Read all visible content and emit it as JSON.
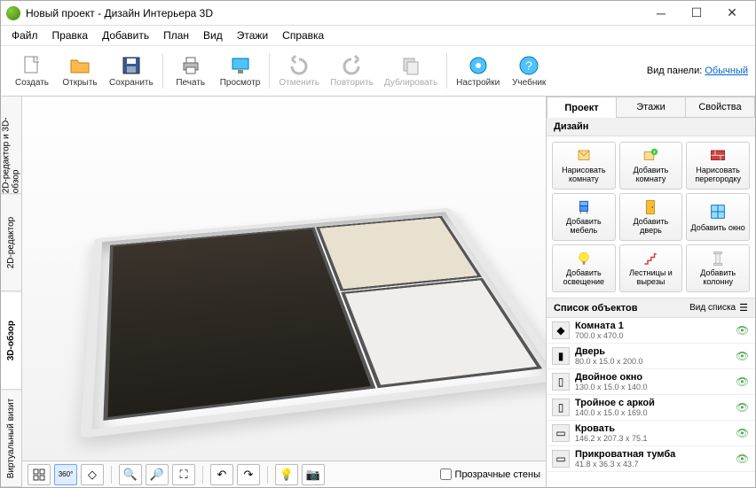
{
  "title": "Новый проект - Дизайн Интерьера 3D",
  "menu": [
    "Файл",
    "Правка",
    "Добавить",
    "План",
    "Вид",
    "Этажи",
    "Справка"
  ],
  "toolbar": {
    "create": "Создать",
    "open": "Открыть",
    "save": "Сохранить",
    "print": "Печать",
    "preview": "Просмотр",
    "undo": "Отменить",
    "redo": "Повторить",
    "dup": "Дублировать",
    "settings": "Настройки",
    "help": "Учебник",
    "panel_label": "Вид панели:",
    "panel_link": "Обычный"
  },
  "vtabs": {
    "both": "2D-редактор и 3D-обзор",
    "editor": "2D-редактор",
    "view3d": "3D-обзор",
    "virtual": "Виртуальный визит"
  },
  "bottombar": {
    "transparent": "Прозрачные стены"
  },
  "rtabs": {
    "project": "Проект",
    "floors": "Этажи",
    "props": "Свойства"
  },
  "design": {
    "header": "Дизайн",
    "draw_room": "Нарисовать комнату",
    "add_room": "Добавить комнату",
    "draw_partition": "Нарисовать перегородку",
    "add_furn": "Добавить мебель",
    "add_door": "Добавить дверь",
    "add_window": "Добавить окно",
    "add_light": "Добавить освещение",
    "stairs": "Лестницы и вырезы",
    "add_column": "Добавить колонну"
  },
  "objects": {
    "header": "Список объектов",
    "viewlabel": "Вид списка",
    "items": [
      {
        "name": "Комната 1",
        "dim": "700.0 x 470.0",
        "type": "room"
      },
      {
        "name": "Дверь",
        "dim": "80.0 x 15.0 x 200.0",
        "type": "door"
      },
      {
        "name": "Двойное окно",
        "dim": "130.0 x 15.0 x 140.0",
        "type": "window"
      },
      {
        "name": "Тройное с аркой",
        "dim": "140.0 x 15.0 x 169.0",
        "type": "window"
      },
      {
        "name": "Кровать",
        "dim": "146.2 x 207.3 x 75.1",
        "type": "furn"
      },
      {
        "name": "Прикроватная тумба",
        "dim": "41.8 x 36.3 x 43.7",
        "type": "furn"
      }
    ]
  }
}
